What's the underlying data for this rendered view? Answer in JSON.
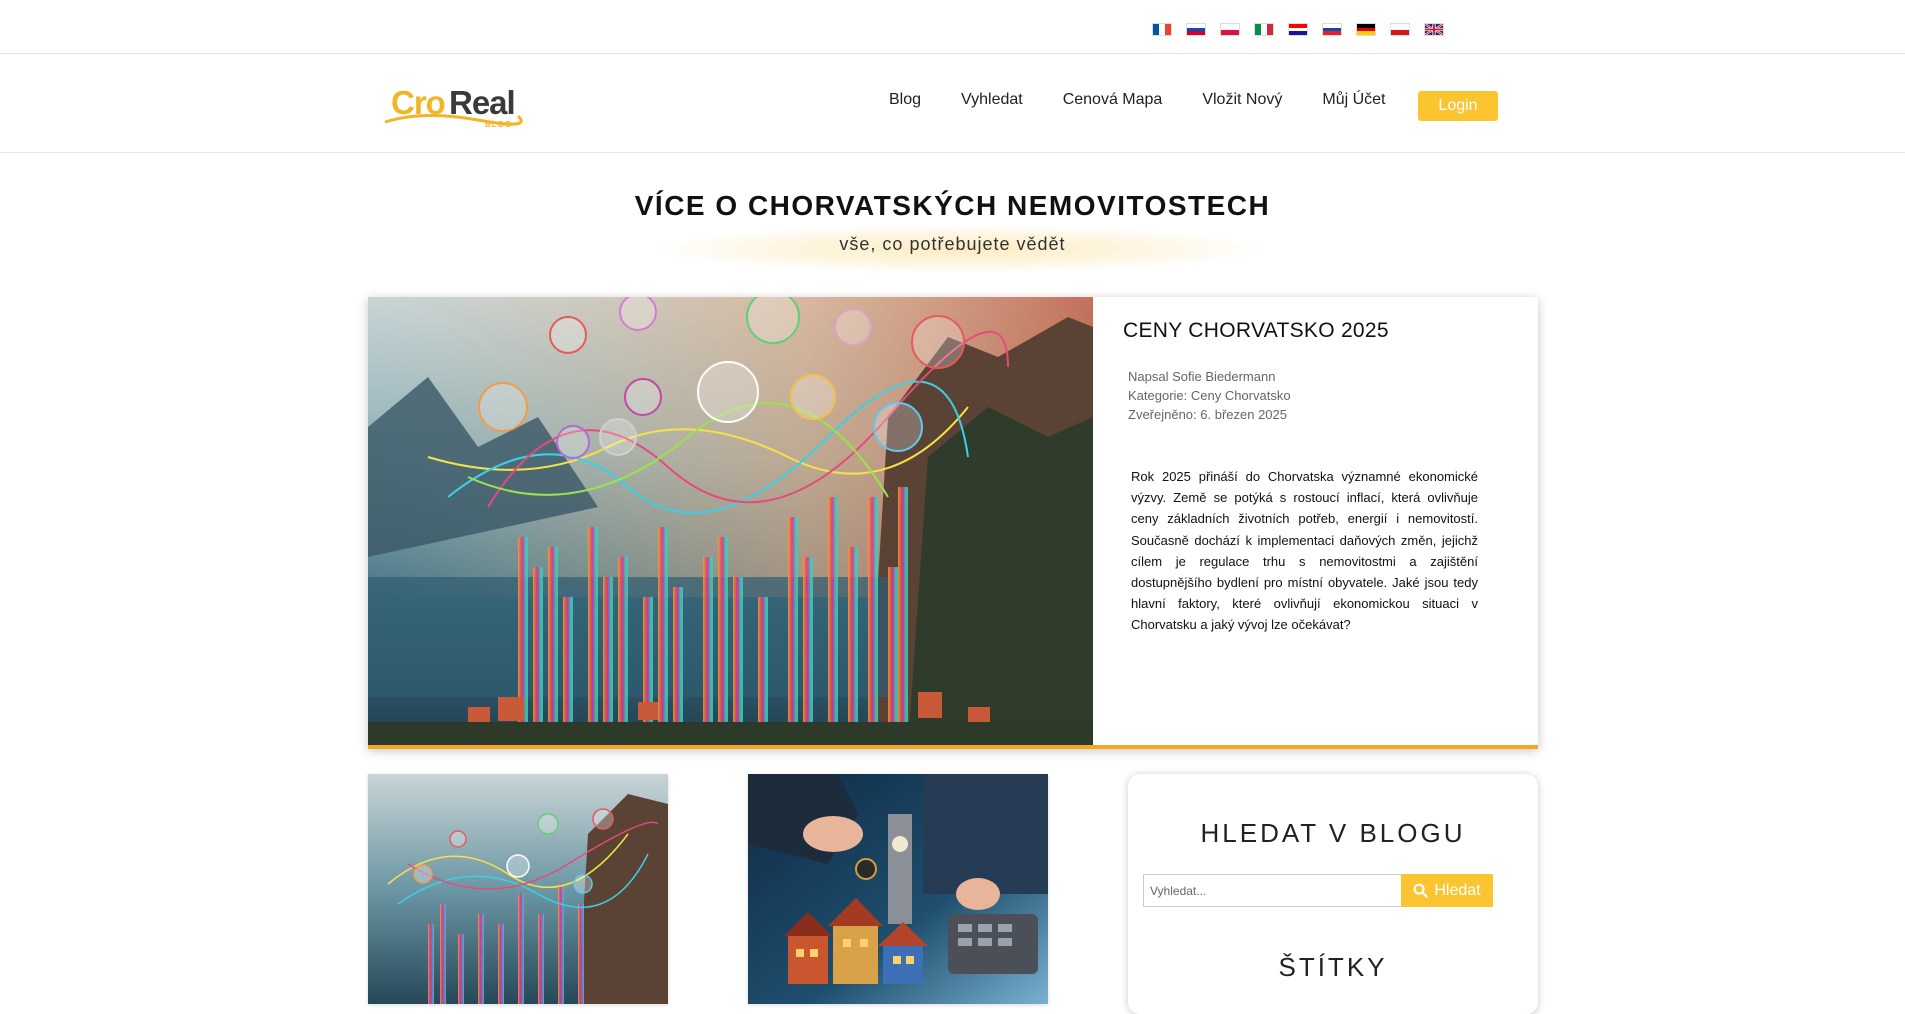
{
  "languages": [
    {
      "code": "fr",
      "colors": [
        "#0055a4",
        "#ffffff",
        "#ef4135"
      ],
      "orientation": "v"
    },
    {
      "code": "si",
      "colors": [
        "#ffffff",
        "#0052b4",
        "#d80027"
      ],
      "orientation": "h"
    },
    {
      "code": "pl",
      "colors": [
        "#ffffff",
        "#dc143c"
      ],
      "orientation": "h"
    },
    {
      "code": "it",
      "colors": [
        "#009246",
        "#ffffff",
        "#ce2b37"
      ],
      "orientation": "v"
    },
    {
      "code": "hr",
      "colors": [
        "#ff0000",
        "#ffffff",
        "#171796"
      ],
      "orientation": "h"
    },
    {
      "code": "sk",
      "colors": [
        "#ffffff",
        "#0b4ea2",
        "#ee1c25"
      ],
      "orientation": "h"
    },
    {
      "code": "de",
      "colors": [
        "#000000",
        "#dd0000",
        "#ffce00"
      ],
      "orientation": "h"
    },
    {
      "code": "cz",
      "colors": [
        "#ffffff",
        "#d7141a"
      ],
      "orientation": "h"
    },
    {
      "code": "gb",
      "colors": [
        "#012169",
        "#ffffff",
        "#c8102e"
      ],
      "orientation": "uk"
    }
  ],
  "logo": {
    "part1": "Cro",
    "part2": "Real",
    "sub": "BLOG"
  },
  "nav": {
    "items": [
      "Blog",
      "Vyhledat",
      "Cenová Mapa",
      "Vložit Nový",
      "Můj Účet"
    ],
    "login": "Login"
  },
  "hero": {
    "title": "VÍCE O CHORVATSKÝCH NEMOVITOSTECH",
    "subtitle": "vše, co potřebujete vědět"
  },
  "featured": {
    "title": "CENY CHORVATSKO 2025",
    "author": "Napsal Sofie Biedermann",
    "category": "Kategorie: Ceny Chorvatsko",
    "published": "Zveřejněno: 6. březen 2025",
    "excerpt": "Rok 2025 přináší do Chorvatska významné ekonomické výzvy. Země se potýká s rostoucí inflací, která ovlivňuje ceny základních životních potřeb, energií i nemovitostí. Současně dochází k implementaci daňových změn, jejichž cílem je regulace trhu s nemovitostmi a zajištění dostupnějšího bydlení pro místní obyvatele. Jaké jsou tedy hlavní faktory, které ovlivňují ekonomickou situaci v Chorvatsku a jaký vývoj lze očekávat?"
  },
  "sidebar": {
    "search_title": "HLEDAT V BLOGU",
    "search_placeholder": "Vyhledat...",
    "search_button": "Hledat",
    "tags_title": "ŠTÍTKY"
  },
  "colors": {
    "accent": "#fbc531",
    "featured_border": "#f5a623"
  }
}
